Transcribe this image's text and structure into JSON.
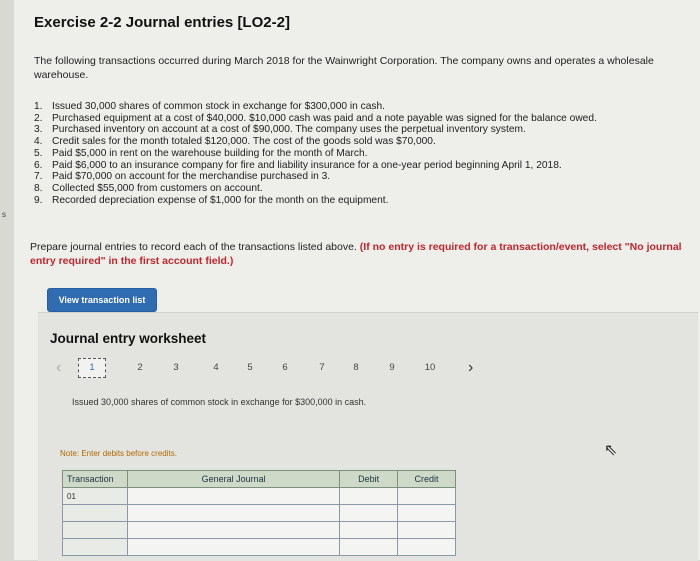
{
  "exercise": {
    "title": "Exercise 2-2 Journal entries [LO2-2]",
    "intro": "The following transactions occurred during March 2018 for the Wainwright Corporation. The company owns and operates a wholesale warehouse."
  },
  "transactions": [
    {
      "num": "1.",
      "text": "Issued 30,000 shares of common stock in exchange for $300,000 in cash."
    },
    {
      "num": "2.",
      "text": "Purchased equipment at a cost of $40,000. $10,000 cash was paid and a note payable was signed for the balance owed."
    },
    {
      "num": "3.",
      "text": "Purchased inventory on account at a cost of $90,000. The company uses the perpetual inventory system."
    },
    {
      "num": "4.",
      "text": "Credit sales for the month totaled $120,000. The cost of the goods sold was $70,000."
    },
    {
      "num": "5.",
      "text": "Paid $5,000 in rent on the warehouse building for the month of March."
    },
    {
      "num": "6.",
      "text": "Paid $6,000 to an insurance company for fire and liability insurance for a one-year period beginning April 1, 2018."
    },
    {
      "num": "7.",
      "text": "Paid $70,000 on account for the merchandise purchased in 3."
    },
    {
      "num": "8.",
      "text": "Collected $55,000 from customers on account."
    },
    {
      "num": "9.",
      "text": "Recorded depreciation expense of $1,000 for the month on the equipment."
    }
  ],
  "prompt": {
    "text": "Prepare journal entries to record each of the transactions listed above.",
    "highlight": "(If no entry is required for a transaction/event, select \"No journal entry required\" in the first account field.)"
  },
  "view_button": "View transaction list",
  "worksheet": {
    "title": "Journal entry worksheet",
    "pages": [
      "1",
      "2",
      "3",
      "4",
      "5",
      "6",
      "7",
      "8",
      "9",
      "10"
    ],
    "active_page": "1",
    "prev_icon": "‹",
    "next_icon": "›",
    "description": "Issued 30,000 shares of common stock in exchange for $300,000 in cash.",
    "note": "Note: Enter debits before credits.",
    "table": {
      "headers": {
        "transaction": "Transaction",
        "journal": "General Journal",
        "debit": "Debit",
        "credit": "Credit"
      },
      "first_transaction": "01"
    }
  },
  "edge_mark": "s"
}
